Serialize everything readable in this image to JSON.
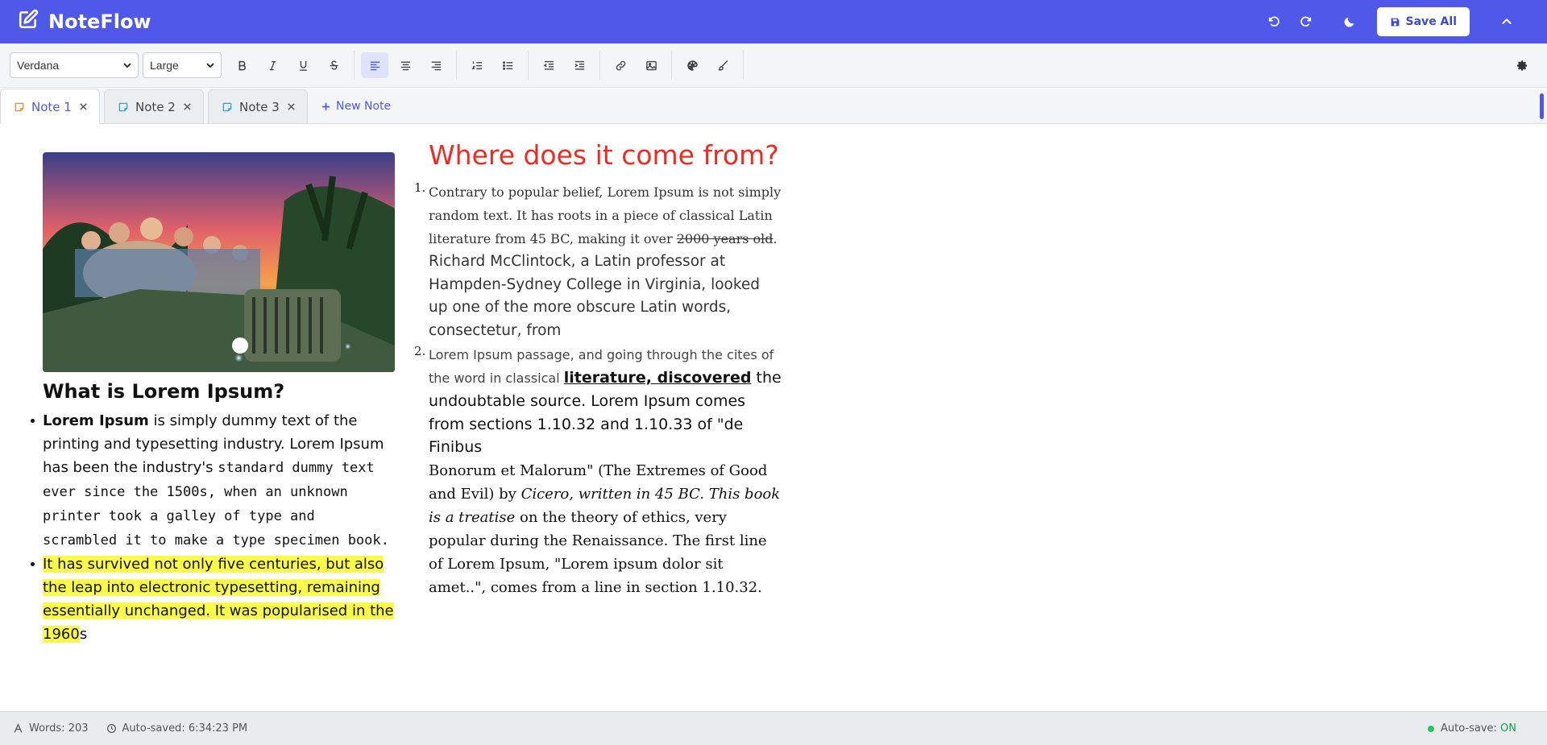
{
  "app": {
    "title": "NoteFlow"
  },
  "header": {
    "save_all_label": "Save All"
  },
  "toolbar": {
    "font": "Verdana",
    "size": "Large"
  },
  "tabs": [
    {
      "label": "Note 1",
      "active": true
    },
    {
      "label": "Note 2",
      "active": false
    },
    {
      "label": "Note 3",
      "active": false
    }
  ],
  "new_note_label": "New Note",
  "left": {
    "heading": "What is Lorem Ipsum?",
    "bullet1": {
      "bold": "Lorem Ipsum",
      "rest1": " is simply dummy text of the printing and typesetting industry. Lorem Ipsum has been the industry's ",
      "mono": "standard dummy text ever since the 1500s, when an unknown printer took a galley of type and scrambled it to make a type specimen book."
    },
    "bullet2": {
      "highlight": "It has survived not only five centuries, but also the leap into electronic typesetting, remaining essentially unchanged. It was popularised in the 1960",
      "tail": "s"
    }
  },
  "right": {
    "heading": "Where does it come from?",
    "item1": {
      "n": "1.",
      "serif": "Contrary to popular belief, Lorem Ipsum is not simply random text. It has roots in a piece of classical Latin literature from 45 BC, making it over ",
      "strike": "2000 years old",
      "dot": ".",
      "sans": "Richard McClintock, a Latin professor at Hampden-Sydney College in Virginia, looked up one of the more obscure Latin words, consectetur, from"
    },
    "item2": {
      "n": "2.",
      "small": "Lorem Ipsum passage, and going through the cites of the word in classical ",
      "boldu": "literature, discovered",
      "md1": " the undoubtable source. Lorem Ipsum comes from sections 1.10.32 and 1.10.33 of \"de Finibus",
      "serif1": "Bonorum et Malorum\" (The Extremes of Good and Evil) by ",
      "italic": "Cicero, written in 45 BC. This book is a treatise",
      "serif2": " on the theory of ethics, very popular during the Renaissance. The first line of Lorem Ipsum, \"Lorem ipsum dolor sit amet..\", comes from a line in section 1.10.32."
    }
  },
  "status": {
    "words": "Words: 203",
    "autosaved": "Auto-saved: 6:34:23 PM",
    "autosave_label": "Auto-save: ",
    "autosave_state": "ON"
  },
  "colors": {
    "brand": "#4f58e8",
    "heading_red": "#ee2b22",
    "highlight": "#fbfb4a",
    "status_on": "#16a34a"
  }
}
